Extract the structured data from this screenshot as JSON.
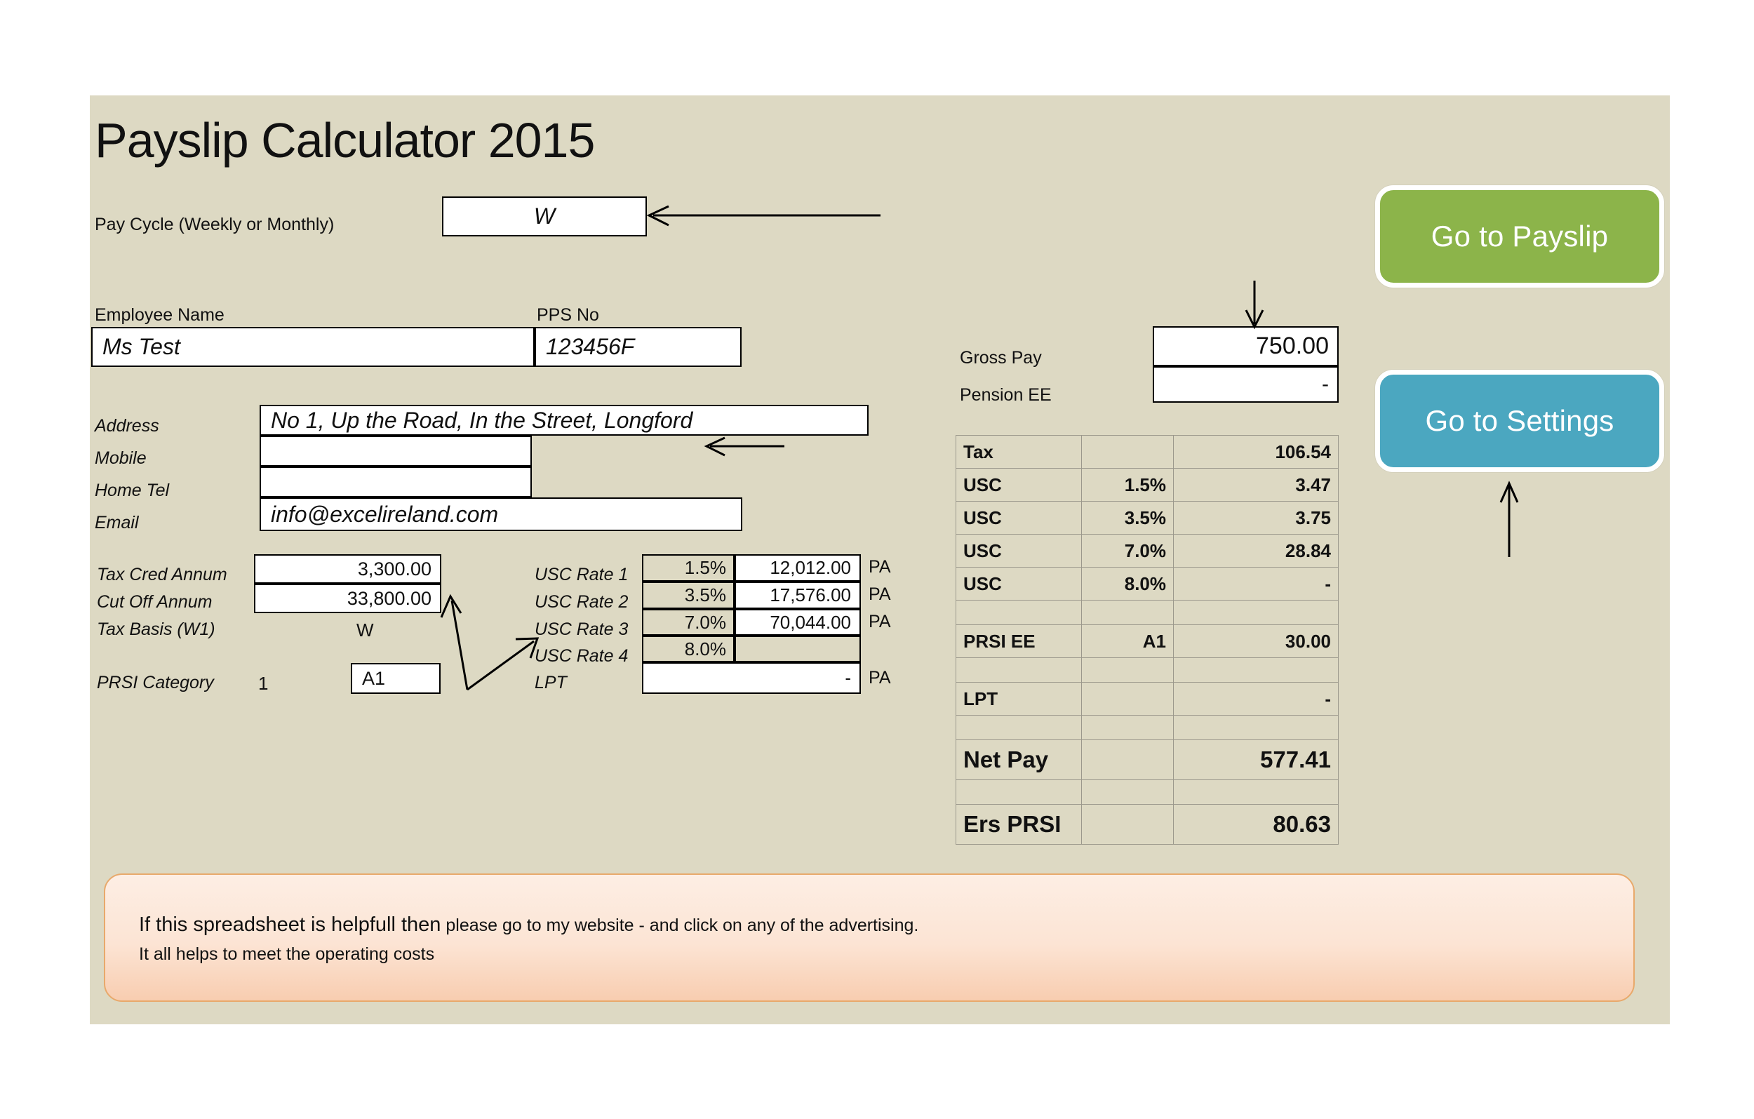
{
  "app": {
    "title": "Payslip Calculator 2015",
    "background_color": "#ddd9c3"
  },
  "pay_cycle": {
    "label": "Pay Cycle (Weekly or Monthly)",
    "value": "W"
  },
  "employee": {
    "name_label": "Employee Name",
    "name_value": "Ms Test",
    "pps_label": "PPS No",
    "pps_value": "123456F",
    "address_label": "Address",
    "address_value": "No 1, Up the Road, In the Street, Longford",
    "mobile_label": "Mobile",
    "mobile_value": "",
    "home_tel_label": "Home Tel",
    "home_tel_value": "",
    "email_label": "Email",
    "email_value": "info@excelireland.com"
  },
  "tax_settings": {
    "tax_cred_label": "Tax Cred Annum",
    "tax_cred_value": "3,300.00",
    "cut_off_label": "Cut Off Annum",
    "cut_off_value": "33,800.00",
    "tax_basis_label": "Tax Basis (W1)",
    "tax_basis_value": "W",
    "prsi_category_label": "PRSI Category",
    "prsi_category_index": "1",
    "prsi_category_value": "A1"
  },
  "usc_bands": {
    "rows": [
      {
        "label": "USC Rate 1",
        "rate": "1.5%",
        "band": "12,012.00",
        "unit": "PA"
      },
      {
        "label": "USC Rate 2",
        "rate": "3.5%",
        "band": "17,576.00",
        "unit": "PA"
      },
      {
        "label": "USC Rate 3",
        "rate": "7.0%",
        "band": "70,044.00",
        "unit": "PA"
      },
      {
        "label": "USC Rate 4",
        "rate": "8.0%",
        "band": "",
        "unit": ""
      }
    ],
    "lpt_label": "LPT",
    "lpt_value": "-",
    "lpt_unit": "PA"
  },
  "pay_inputs": {
    "gross_pay_label": "Gross Pay",
    "gross_pay_value": "750.00",
    "pension_ee_label": "Pension EE",
    "pension_ee_value": "-"
  },
  "results_table": {
    "rows": [
      {
        "name": "Tax",
        "rate": "",
        "amount": "106.54",
        "blank": false,
        "big": false
      },
      {
        "name": "USC",
        "rate": "1.5%",
        "amount": "3.47",
        "blank": false,
        "big": false
      },
      {
        "name": "USC",
        "rate": "3.5%",
        "amount": "3.75",
        "blank": false,
        "big": false
      },
      {
        "name": "USC",
        "rate": "7.0%",
        "amount": "28.84",
        "blank": false,
        "big": false
      },
      {
        "name": "USC",
        "rate": "8.0%",
        "amount": "-",
        "blank": false,
        "big": false
      },
      {
        "name": "",
        "rate": "",
        "amount": "",
        "blank": true,
        "big": false
      },
      {
        "name": "PRSI EE",
        "rate": "A1",
        "amount": "30.00",
        "blank": false,
        "big": false
      },
      {
        "name": "",
        "rate": "",
        "amount": "",
        "blank": true,
        "big": false
      },
      {
        "name": "LPT",
        "rate": "",
        "amount": "-",
        "blank": false,
        "big": false
      },
      {
        "name": "",
        "rate": "",
        "amount": "",
        "blank": true,
        "big": false
      },
      {
        "name": "Net Pay",
        "rate": "",
        "amount": "577.41",
        "blank": false,
        "big": true
      },
      {
        "name": "",
        "rate": "",
        "amount": "",
        "blank": true,
        "big": false
      },
      {
        "name": "Ers PRSI",
        "rate": "",
        "amount": "80.63",
        "blank": false,
        "big": true
      }
    ]
  },
  "buttons": {
    "payslip": {
      "label": "Go to Payslip",
      "color": "#8cb44a"
    },
    "settings": {
      "label": "Go to Settings",
      "color": "#4ba7c0"
    }
  },
  "note": {
    "line1_strong": "If this spreadsheet is helpfull then",
    "line1_rest": " please go to my website  - and click on any of the advertising.",
    "line2": "It all helps to meet the operating costs",
    "border_color": "#e8a96b"
  }
}
